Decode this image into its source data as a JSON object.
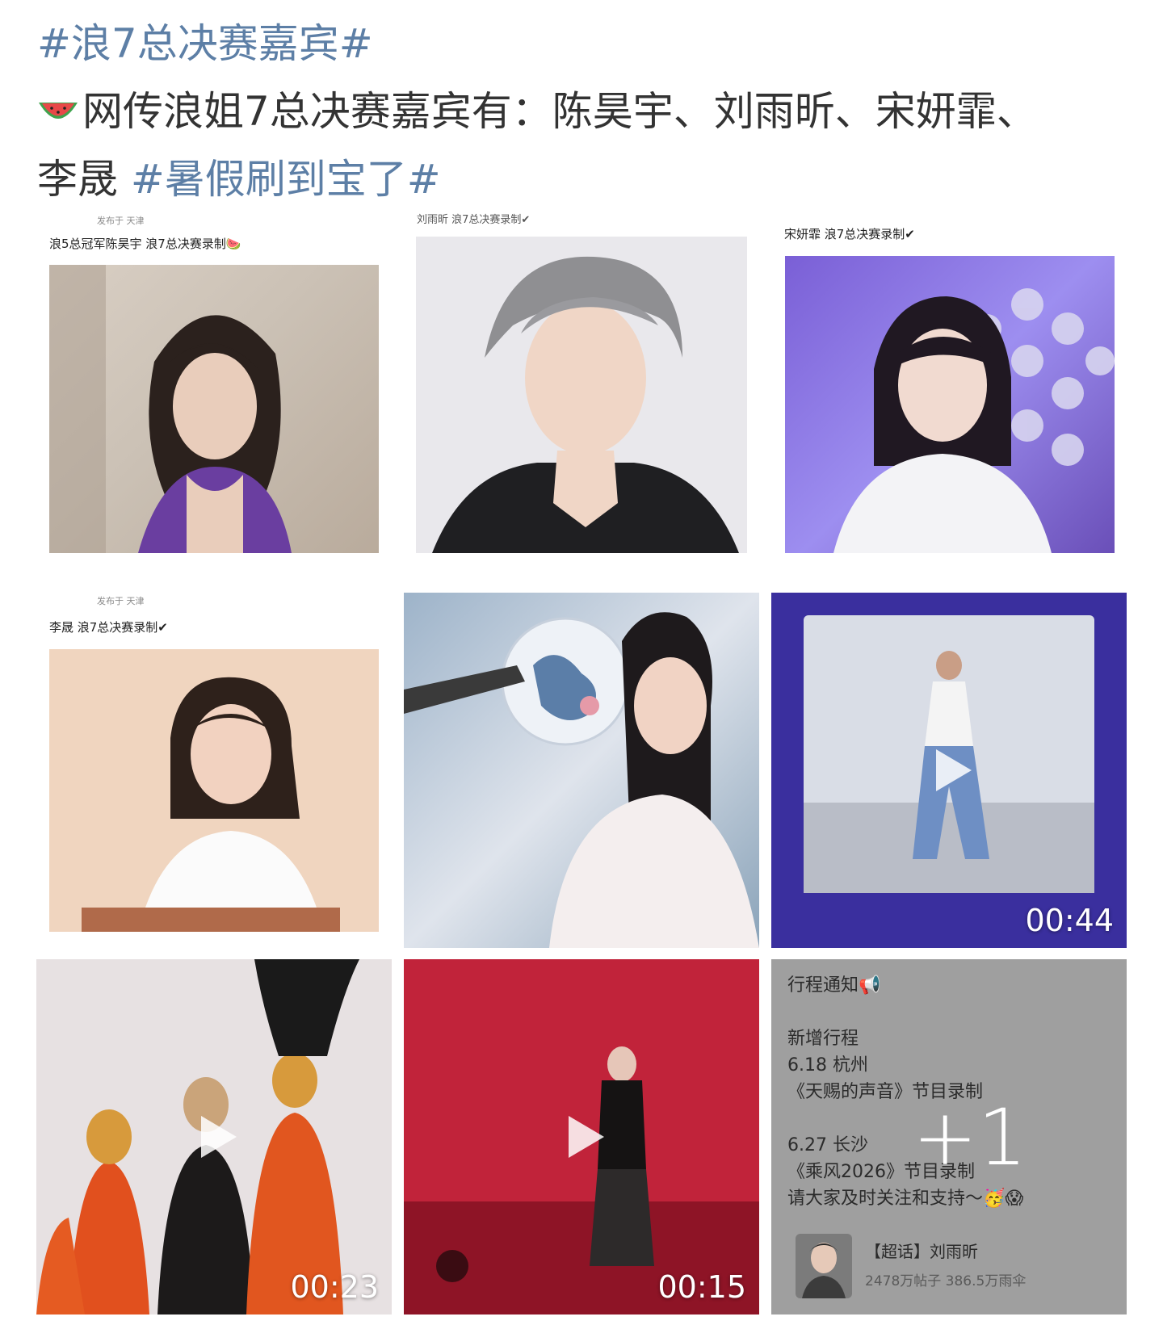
{
  "post": {
    "hashtag_top": "#浪7总决赛嘉宾#",
    "line1": "网传浪姐7总决赛嘉宾有：陈昊宇、刘雨昕、宋妍霏、",
    "line2_name": "李晟 ",
    "hashtag_bottom": "#暑假刷到宝了#",
    "emoji": "watermelon-icon"
  },
  "tiles": {
    "t1": {
      "location": "发布于 天津",
      "caption": "浪5总冠军陈昊宇  浪7总决赛录制🍉"
    },
    "t2": {
      "caption": "刘雨昕  浪7总决赛录制✔"
    },
    "t3": {
      "caption": "宋妍霏  浪7总决赛录制✔"
    },
    "t4": {
      "location": "发布于 天津",
      "caption": "李晟  浪7总决赛录制✔"
    },
    "t6": {
      "duration": "00:44"
    },
    "t7": {
      "duration": "00:23"
    },
    "t8": {
      "duration": "00:15"
    },
    "t9": {
      "title": "行程通知📢",
      "line1": "新增行程",
      "line2": "6.18 杭州",
      "line3": "《天赐的声音》节目录制",
      "line4": "6.27 长沙",
      "line5": "《乘风2026》节目录制",
      "line6": "请大家及时关注和支持～🥳😱",
      "more": "+1",
      "card_title": "【超话】刘雨昕",
      "card_stats": "2478万帖子  386.5万雨伞"
    }
  },
  "colors": {
    "hashtag": "#5d7fa6",
    "text": "#333333",
    "notice_bg": "#9f9f9f"
  }
}
